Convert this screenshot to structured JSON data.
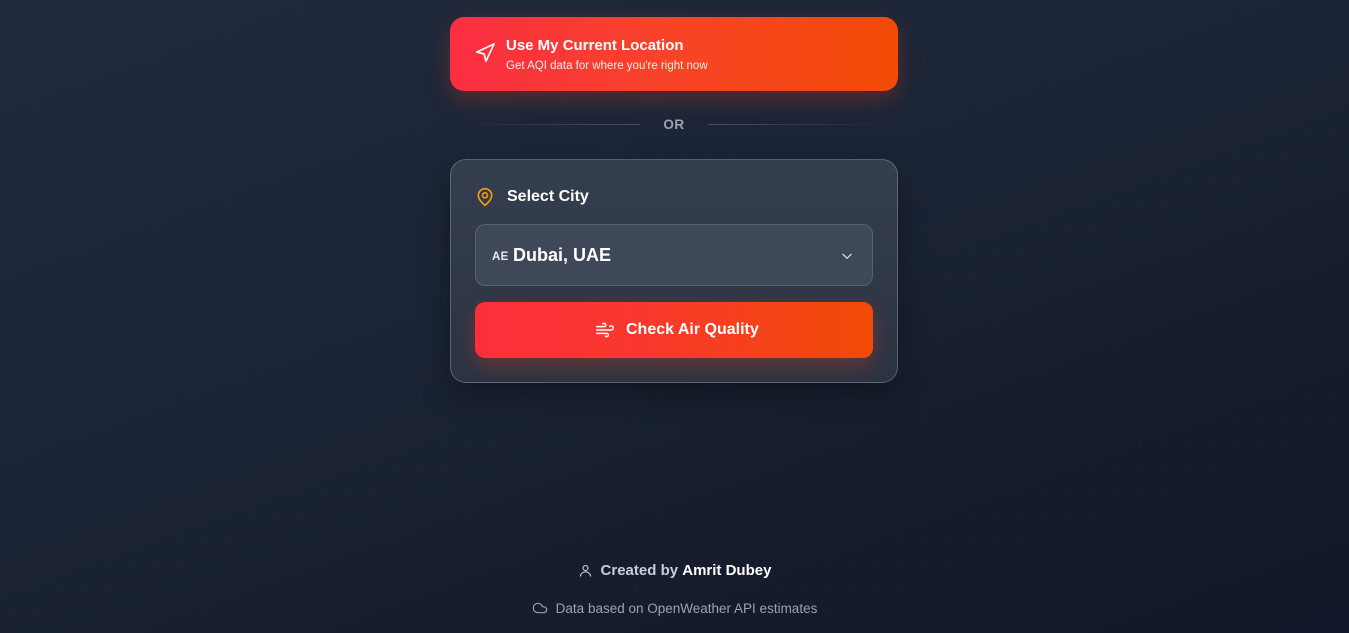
{
  "location_button": {
    "title": "Use My Current Location",
    "subtitle": "Get AQI data for where you're right now",
    "icon": "navigation-arrow-icon"
  },
  "divider": {
    "text": "OR"
  },
  "city_card": {
    "label": "Select City",
    "label_icon": "map-pin-icon",
    "select": {
      "country_code": "AE",
      "selected_value": "Dubai, UAE",
      "icon": "chevron-down-icon"
    },
    "check_button": {
      "label": "Check Air Quality",
      "icon": "wind-icon"
    }
  },
  "footer": {
    "credit_prefix": "Created by",
    "credit_name": "Amrit Dubey",
    "credit_icon": "user-icon",
    "source_text": "Data based on OpenWeather API estimates",
    "source_icon": "cloud-icon"
  },
  "colors": {
    "accent_start": "#fb2d44",
    "accent_end": "#f24b05",
    "pin": "#f59e0b",
    "background": "#1b2436"
  }
}
